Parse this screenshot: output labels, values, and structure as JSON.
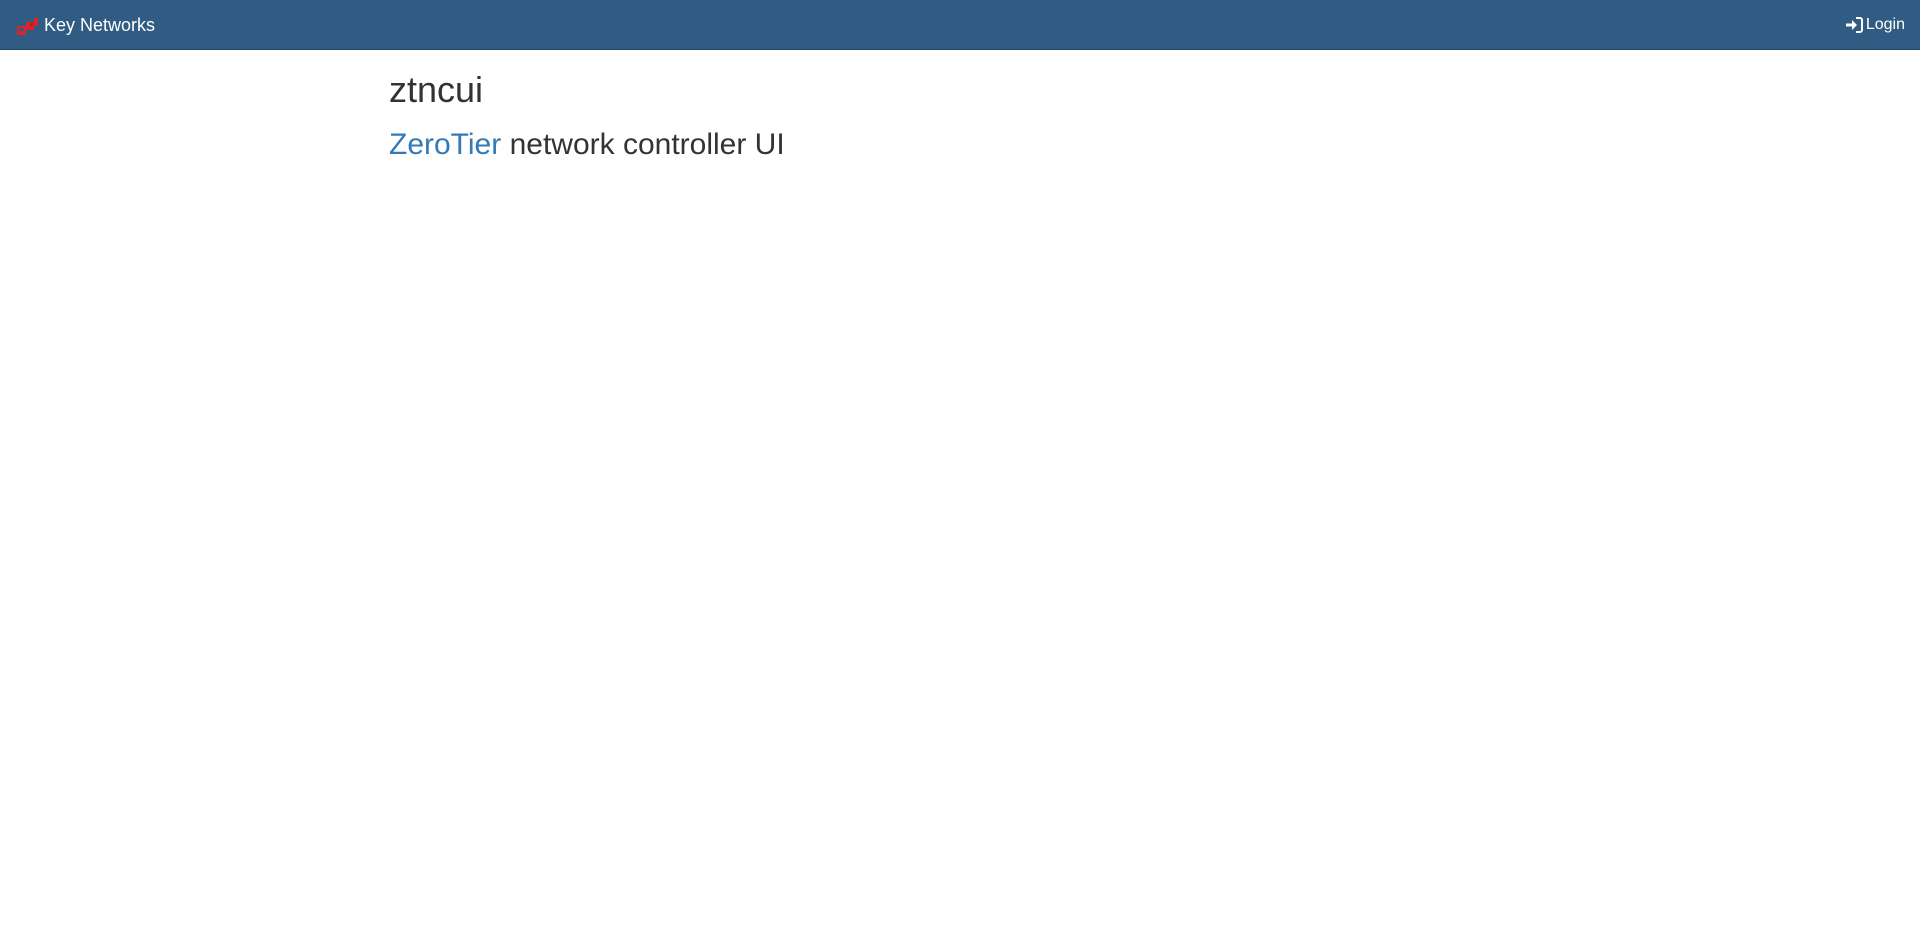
{
  "navbar": {
    "brand_label": "Key Networks",
    "brand_icon": "key-networks-logo-icon",
    "login_label": "Login",
    "login_icon": "log-in-icon",
    "background_color": "#305b82",
    "logo_color": "#d9242b"
  },
  "main": {
    "title": "ztncui",
    "subtitle_link": "ZeroTier",
    "subtitle_rest": " network controller UI",
    "link_color": "#337ab7"
  }
}
